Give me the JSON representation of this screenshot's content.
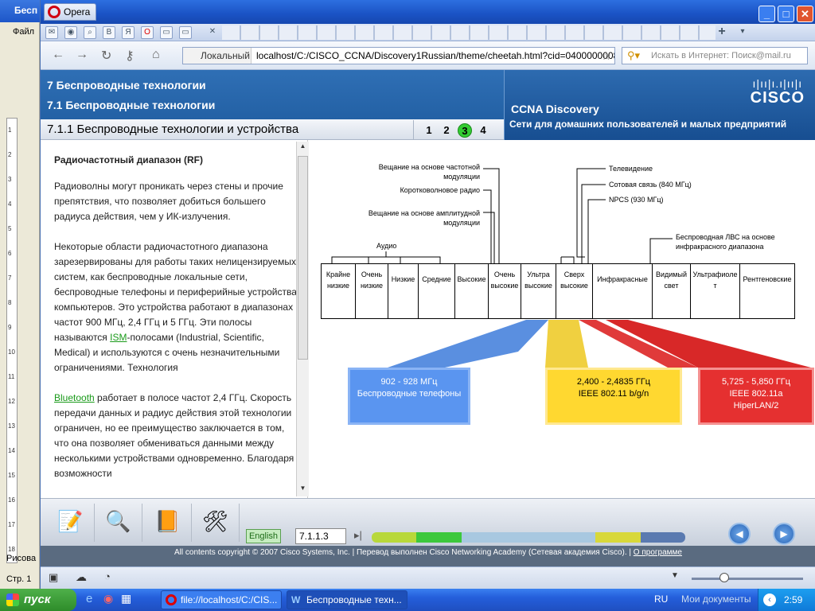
{
  "word": {
    "title_fragment": "Бесп",
    "menu_fragment": "Файл",
    "draw_fragment": "Рисова",
    "status_fragment": "Стр. 1",
    "ruler_numbers": [
      "1",
      "2",
      "3",
      "4",
      "5",
      "6",
      "7",
      "8",
      "9",
      "10",
      "11",
      "12",
      "13",
      "14",
      "15",
      "16",
      "17",
      "18"
    ]
  },
  "browser": {
    "app_name": "Opera",
    "address_local": "Локальный",
    "address_url": "localhost/C:/CISCO_CCNA/Discovery1Russian/theme/cheetah.html?cid=0400000008l1",
    "search_placeholder": "Искать в Интернет: Поиск@mail.ru",
    "tab_icons": [
      "mail-icon",
      "bird-icon",
      "search-icon",
      "vk-icon",
      "yandex-icon",
      "opera-icon",
      "page-icon",
      "page-icon",
      "page-icon"
    ]
  },
  "course": {
    "chapter": "7 Беспроводные технологии",
    "section": "7.1 Беспроводные технологии",
    "subsection": "7.1.1 Беспроводные технологии и устройства",
    "pages": [
      "1",
      "2",
      "3",
      "4"
    ],
    "active_page": "3",
    "brand": "CISCO",
    "product": "CCNA Discovery",
    "product_subtitle": "Сети для домашних пользователей и малых предприятий"
  },
  "text": {
    "heading": "Радиочастотный диапазон (RF)",
    "p1": "Радиоволны могут проникать через стены и прочие препятствия, что позволяет добиться большего радиуса действия, чем у ИК-излучения.",
    "p2_before": "Некоторые области радиочастотного диапазона зарезервированы для работы таких нелицензируемых систем, как беспроводные локальные сети, беспроводные телефоны и периферийные устройства компьютеров. Это устройства работают в диапазонах частот 900 МГц, 2,4 ГГц и 5 ГГц. Эти полосы называются ",
    "p2_link": "ISM",
    "p2_after": "-полосами (Industrial, Scientific, Medical) и используются с очень незначительными ограничениями. Технология",
    "p3_link": "Bluetooth",
    "p3_after": " работает в полосе частот 2,4 ГГц. Скорость передачи данных и радиус действия этой технологии ограничен, но ее преимущество заключается в том, что она позволяет обмениваться данными между несколькими устройствами одновременно. Благодаря возможности"
  },
  "diagram": {
    "labels": {
      "fm": "Вещание на основе частотной модуляции",
      "sw": "Коротковолновое радио",
      "am": "Вещание на основе амплитудной модуляции",
      "audio": "Аудио",
      "tv": "Телевидение",
      "cell": "Сотовая связь (840 МГц)",
      "npcs": "NPCS (930 МГц)",
      "irlan": "Беспроводная ЛВС на основе инфракрасного диапазона"
    },
    "bands": [
      "Крайне низкие",
      "Очень низкие",
      "Низкие",
      "Средние",
      "Высокие",
      "Очень высокие",
      "Ультра высокие",
      "Сверх высокие",
      "Инфракрасные",
      "Видимый свет",
      "Ультрафиоле т",
      "Рентгеновские"
    ],
    "boxes": [
      {
        "freq": "902 - 928 МГц",
        "desc": "Беспроводные телефоны",
        "desc2": ""
      },
      {
        "freq": "2,400 - 2,4835 ГГц",
        "desc": "IEEE 802.11 b/g/n",
        "desc2": ""
      },
      {
        "freq": "5,725 - 5,850 ГГц",
        "desc": "IEEE 802.11a",
        "desc2": "HiperLAN/2"
      }
    ]
  },
  "footer": {
    "language": "English",
    "nav_value": "7.1.1.3",
    "copyright": "All contents copyright © 2007 Cisco Systems, Inc. | Перевод выполнен Cisco Networking Academy (Сетевая академия Cisco). |",
    "about": "О программе",
    "progress_colors": [
      "#b8d83a",
      "#3cc83c",
      "#a8c8e0",
      "#a8c8e0",
      "#a8c8e0",
      "#d8d83a",
      "#5a7ab0"
    ]
  },
  "taskbar": {
    "start": "пуск",
    "tasks": [
      "file://localhost/C:/CIS...",
      "Беспроводные техн..."
    ],
    "lang": "RU",
    "docs": "Мои документы",
    "time": "2:59"
  }
}
